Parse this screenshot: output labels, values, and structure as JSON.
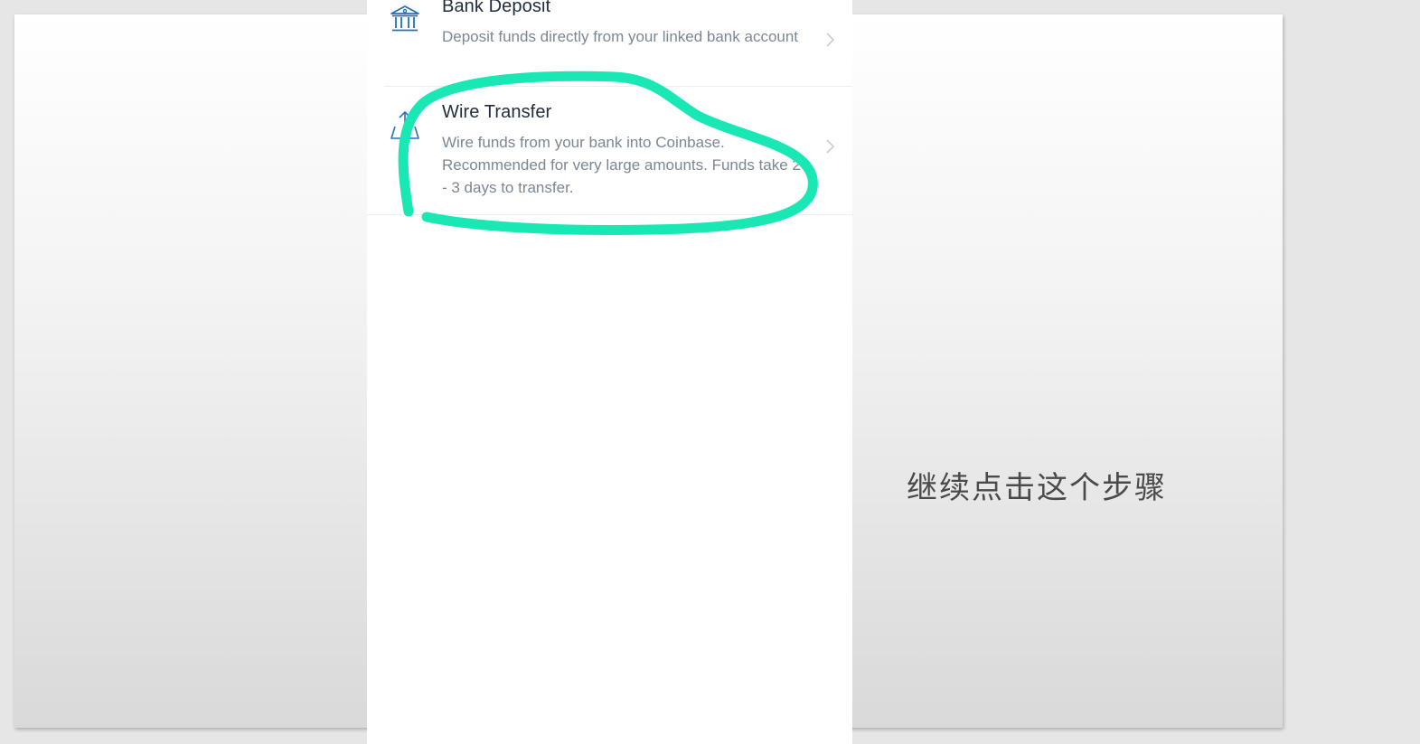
{
  "deposit_options": [
    {
      "title": "Bank Deposit",
      "description": "Deposit funds directly from your linked bank account",
      "icon": "bank-icon"
    },
    {
      "title": "Wire Transfer",
      "description": "Wire funds from your bank into Coinbase. Recommended for very large amounts. Funds take 2 - 3 days to transfer.",
      "icon": "wire-transfer-icon"
    }
  ],
  "caption": "继续点击这个步骤",
  "colors": {
    "highlight_stroke": "#19e8b5",
    "icon_blue": "#2a6fb8",
    "title_text": "#1f2d3d",
    "description_text": "#7b8794"
  }
}
